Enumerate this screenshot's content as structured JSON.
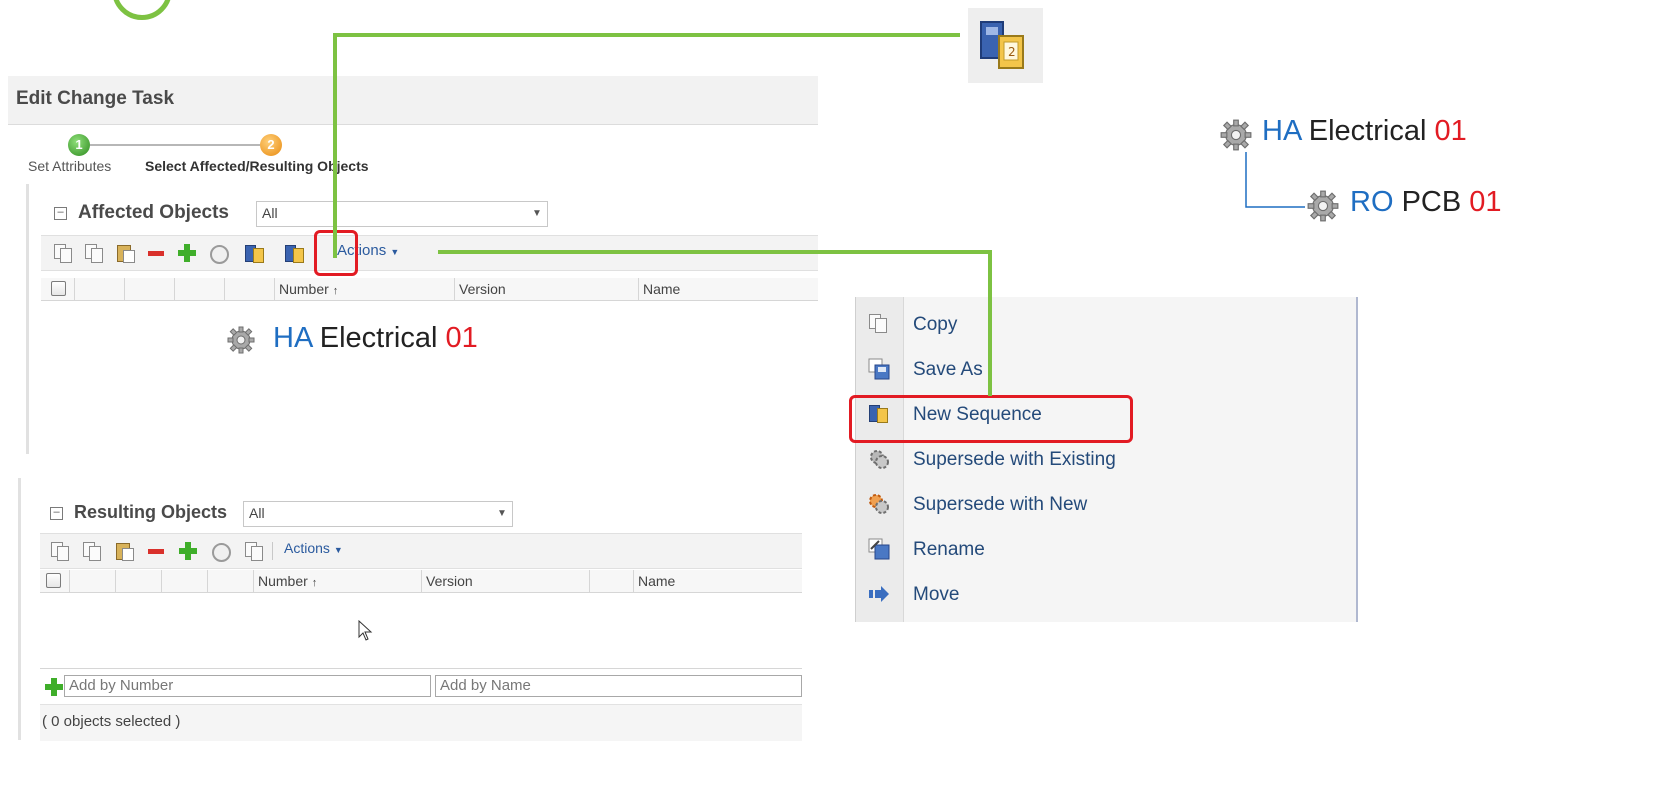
{
  "dialog": {
    "title": "Edit Change Task",
    "steps": [
      {
        "number": "1",
        "label": "Set Attributes"
      },
      {
        "number": "2",
        "label": "Select Affected/Resulting Objects"
      }
    ]
  },
  "affected": {
    "title": "Affected Objects",
    "filter_value": "All",
    "actions_label": "Actions",
    "columns": [
      "Number",
      "Version",
      "Name"
    ],
    "sort_indicator": "↑",
    "item": {
      "prefix": "HA",
      "name": "Electrical",
      "suffix": "01"
    }
  },
  "resulting": {
    "title": "Resulting Objects",
    "filter_value": "All",
    "actions_label": "Actions",
    "columns": [
      "Number",
      "Version",
      "Name"
    ],
    "sort_indicator": "↑",
    "add_by_number_placeholder": "Add by Number",
    "add_by_name_placeholder": "Add by Name",
    "status": "( 0 objects selected )"
  },
  "menu": {
    "items": [
      {
        "label": "Copy",
        "icon": "copy-icon"
      },
      {
        "label": "Save As",
        "icon": "save-as-icon"
      },
      {
        "label": "New Sequence",
        "icon": "new-sequence-icon"
      },
      {
        "label": "Supersede with Existing",
        "icon": "supersede-existing-icon"
      },
      {
        "label": "Supersede with New",
        "icon": "supersede-new-icon"
      },
      {
        "label": "Rename",
        "icon": "rename-icon"
      },
      {
        "label": "Move",
        "icon": "move-icon"
      }
    ],
    "highlighted": "New Sequence"
  },
  "tree": {
    "parent": {
      "prefix": "HA",
      "name": "Electrical",
      "suffix": "01"
    },
    "child": {
      "prefix": "RO",
      "name": "PCB",
      "suffix": "01"
    }
  },
  "colors": {
    "accent_green": "#7dc242",
    "highlight_red": "#e21b23",
    "prefix_blue": "#1f6ec2"
  }
}
